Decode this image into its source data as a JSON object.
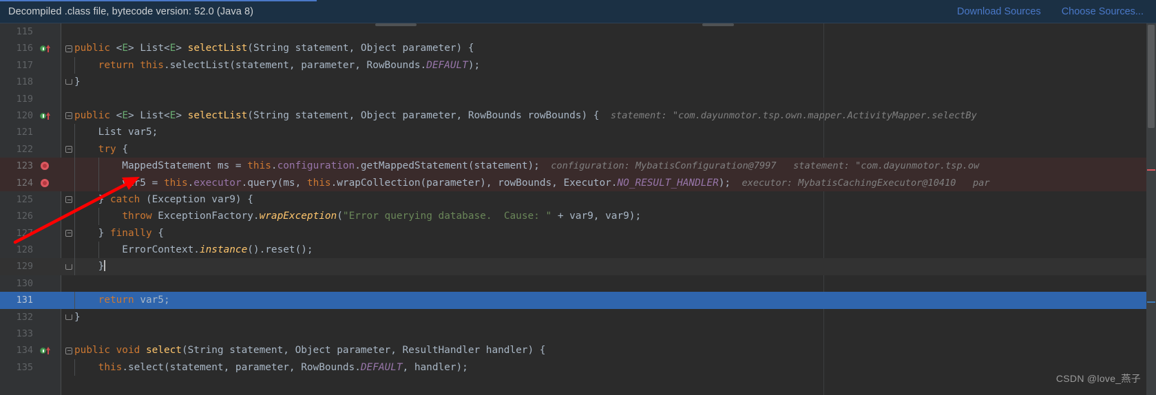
{
  "banner": {
    "message": "Decompiled .class file, bytecode version: 52.0 (Java 8)",
    "download_label": "Download Sources",
    "choose_label": "Choose Sources..."
  },
  "watermark": "CSDN @love_燕子",
  "colors": {
    "banner_bg": "#1b3044",
    "link": "#4a78c8",
    "editor_bg": "#2b2b2b",
    "gutter_bg": "#313335",
    "selected_line": "#2f65ad",
    "exec_line": "#3a2b2b",
    "keyword": "#cc7832",
    "string": "#6a8759",
    "method": "#ffc66d",
    "field": "#9876aa",
    "default_text": "#a9b7c6",
    "hint": "#808080",
    "breakpoint": "#db5860",
    "arrow": "#ff0000"
  },
  "editor": {
    "lines": [
      {
        "num": "115",
        "indent": 0,
        "tokens": []
      },
      {
        "num": "116",
        "indent": 0,
        "marker": "override",
        "fold": "start",
        "tokens": [
          {
            "t": "public ",
            "c": "kw"
          },
          {
            "t": "<",
            "c": "plain"
          },
          {
            "t": "E",
            "c": "gen"
          },
          {
            "t": "> List<",
            "c": "plain"
          },
          {
            "t": "E",
            "c": "gen"
          },
          {
            "t": "> ",
            "c": "plain"
          },
          {
            "t": "selectList",
            "c": "mth"
          },
          {
            "t": "(String statement, Object parameter) {",
            "c": "plain"
          }
        ]
      },
      {
        "num": "117",
        "indent": 1,
        "tokens": [
          {
            "t": "    ",
            "c": "plain"
          },
          {
            "t": "return ",
            "c": "kw"
          },
          {
            "t": "this",
            "c": "kw"
          },
          {
            "t": ".selectList(statement, parameter, RowBounds.",
            "c": "plain"
          },
          {
            "t": "DEFAULT",
            "c": "sconst"
          },
          {
            "t": ");",
            "c": "plain"
          }
        ]
      },
      {
        "num": "118",
        "indent": 0,
        "fold": "end",
        "tokens": [
          {
            "t": "}",
            "c": "plain"
          }
        ]
      },
      {
        "num": "119",
        "indent": 0,
        "tokens": []
      },
      {
        "num": "120",
        "indent": 0,
        "marker": "override",
        "fold": "start",
        "tokens": [
          {
            "t": "public ",
            "c": "kw"
          },
          {
            "t": "<",
            "c": "plain"
          },
          {
            "t": "E",
            "c": "gen"
          },
          {
            "t": "> List<",
            "c": "plain"
          },
          {
            "t": "E",
            "c": "gen"
          },
          {
            "t": "> ",
            "c": "plain"
          },
          {
            "t": "selectList",
            "c": "mth"
          },
          {
            "t": "(String statement, Object parameter, RowBounds rowBounds) {",
            "c": "plain"
          }
        ],
        "hint": "  statement: \"com.dayunmotor.tsp.own.mapper.ActivityMapper.selectBy"
      },
      {
        "num": "121",
        "indent": 1,
        "tokens": [
          {
            "t": "    List var5;",
            "c": "plain"
          }
        ]
      },
      {
        "num": "122",
        "indent": 1,
        "fold": "start",
        "tokens": [
          {
            "t": "    ",
            "c": "plain"
          },
          {
            "t": "try",
            "c": "kw"
          },
          {
            "t": " {",
            "c": "plain"
          }
        ]
      },
      {
        "num": "123",
        "indent": 2,
        "marker": "breakpoint",
        "highlight": "exec",
        "tokens": [
          {
            "t": "        MappedStatement ms = ",
            "c": "plain"
          },
          {
            "t": "this",
            "c": "kw"
          },
          {
            "t": ".",
            "c": "plain"
          },
          {
            "t": "configuration",
            "c": "fld"
          },
          {
            "t": ".getMappedStatement(statement);",
            "c": "plain"
          }
        ],
        "hint": "  configuration: MybatisConfiguration@7997   statement: \"com.dayunmotor.tsp.ow"
      },
      {
        "num": "124",
        "indent": 2,
        "marker": "breakpoint",
        "highlight": "exec",
        "tokens": [
          {
            "t": "        var5 = ",
            "c": "plain"
          },
          {
            "t": "this",
            "c": "kw"
          },
          {
            "t": ".",
            "c": "plain"
          },
          {
            "t": "executor",
            "c": "fld"
          },
          {
            "t": ".query(ms, ",
            "c": "plain"
          },
          {
            "t": "this",
            "c": "kw"
          },
          {
            "t": ".wrapCollection(parameter), rowBounds, Executor.",
            "c": "plain"
          },
          {
            "t": "NO_RESULT_HANDLER",
            "c": "sconst"
          },
          {
            "t": ");",
            "c": "plain"
          }
        ],
        "hint": "  executor: MybatisCachingExecutor@10410   par"
      },
      {
        "num": "125",
        "indent": 1,
        "fold": "start",
        "tokens": [
          {
            "t": "    } ",
            "c": "plain"
          },
          {
            "t": "catch",
            "c": "kw"
          },
          {
            "t": " (Exception var9) {",
            "c": "plain"
          }
        ]
      },
      {
        "num": "126",
        "indent": 2,
        "tokens": [
          {
            "t": "        ",
            "c": "plain"
          },
          {
            "t": "throw ",
            "c": "kw"
          },
          {
            "t": "ExceptionFactory.",
            "c": "plain"
          },
          {
            "t": "wrapException",
            "c": "mi"
          },
          {
            "t": "(",
            "c": "plain"
          },
          {
            "t": "\"Error querying database.  Cause: \"",
            "c": "str"
          },
          {
            "t": " + var9, var9);",
            "c": "plain"
          }
        ]
      },
      {
        "num": "127",
        "indent": 1,
        "fold": "start",
        "tokens": [
          {
            "t": "    } ",
            "c": "plain"
          },
          {
            "t": "finally",
            "c": "kw"
          },
          {
            "t": " {",
            "c": "plain"
          }
        ]
      },
      {
        "num": "128",
        "indent": 2,
        "tokens": [
          {
            "t": "        ErrorContext.",
            "c": "plain"
          },
          {
            "t": "instance",
            "c": "mi"
          },
          {
            "t": "().reset();",
            "c": "plain"
          }
        ]
      },
      {
        "num": "129",
        "indent": 1,
        "fold": "end",
        "highlight": "cursor",
        "caret": true,
        "tokens": [
          {
            "t": "    }",
            "c": "plain"
          }
        ]
      },
      {
        "num": "130",
        "indent": 0,
        "tokens": []
      },
      {
        "num": "131",
        "indent": 1,
        "highlight": "selected",
        "tokens": [
          {
            "t": "    ",
            "c": "plain"
          },
          {
            "t": "return ",
            "c": "kw"
          },
          {
            "t": "var5;",
            "c": "plain"
          }
        ]
      },
      {
        "num": "132",
        "indent": 0,
        "fold": "end",
        "tokens": [
          {
            "t": "}",
            "c": "plain"
          }
        ]
      },
      {
        "num": "133",
        "indent": 0,
        "tokens": []
      },
      {
        "num": "134",
        "indent": 0,
        "marker": "override",
        "fold": "start",
        "tokens": [
          {
            "t": "public void ",
            "c": "kw"
          },
          {
            "t": "select",
            "c": "mth"
          },
          {
            "t": "(String statement, Object parameter, ResultHandler handler) {",
            "c": "plain"
          }
        ]
      },
      {
        "num": "135",
        "indent": 1,
        "clipped": true,
        "tokens": [
          {
            "t": "    ",
            "c": "plain"
          },
          {
            "t": "this",
            "c": "kw"
          },
          {
            "t": ".select(statement, parameter, RowBounds.",
            "c": "plain"
          },
          {
            "t": "DEFAULT",
            "c": "sconst"
          },
          {
            "t": ", handler);",
            "c": "plain"
          }
        ]
      }
    ]
  }
}
